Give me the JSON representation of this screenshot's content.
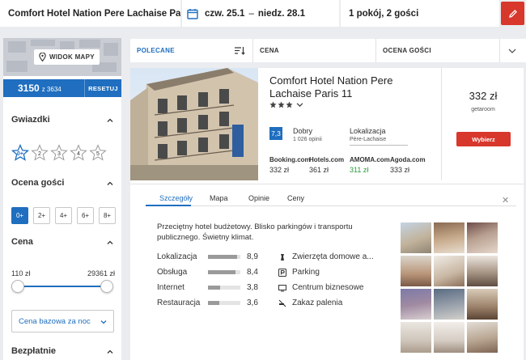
{
  "search": {
    "hotel": "Comfort Hotel Nation Pere Lachaise Pa",
    "date_from": "czw. 25.1",
    "date_sep": "–",
    "date_to": "niedz. 28.1",
    "guests": "1 pokój, 2 gości"
  },
  "sidebar": {
    "map_button": "WIDOK MAPY",
    "price_value": "3150",
    "price_of": "z 3634",
    "reset": "RESETUJ",
    "stars_title": "Gwiazdki",
    "stars": [
      "0+",
      "2",
      "3",
      "4",
      "5"
    ],
    "rating_title": "Ocena gości",
    "ratings": [
      "0+",
      "2+",
      "4+",
      "6+",
      "8+"
    ],
    "price_title": "Cena",
    "price_min": "110 zł",
    "price_max": "29361 zł",
    "price_dropdown": "Cena bazowa za noc",
    "free_title": "Bezpłatnie"
  },
  "sortbar": {
    "recommended": "POLECANE",
    "price": "CENA",
    "rating": "OCENA GOŚCI"
  },
  "hotel": {
    "name": "Comfort Hotel Nation Pere Lachaise Paris 11",
    "stars": 3,
    "rating": "7,3",
    "rating_text": "Dobry",
    "rating_count": "1 026 opinii",
    "location_label": "Lokalizacja",
    "location_value": "Père-Lachaise",
    "providers": [
      {
        "name": "Booking.com",
        "price": "332 zł"
      },
      {
        "name": "Hotels.com",
        "price": "361 zł"
      },
      {
        "name": "AMOMA.com",
        "price": "311 zł"
      },
      {
        "name": "Agoda.com",
        "price": "333 zł"
      }
    ],
    "best_price": "332 zł",
    "best_provider": "getaroom",
    "select_button": "Wybierz"
  },
  "details": {
    "tabs": [
      "Szczegóły",
      "Mapa",
      "Opinie",
      "Ceny"
    ],
    "description": "Przeciętny hotel budżetowy. Blisko parkingów i transportu publicznego. Świetny klimat.",
    "scores": [
      {
        "label": "Lokalizacja",
        "value": "8,9"
      },
      {
        "label": "Obsługa",
        "value": "8,4"
      },
      {
        "label": "Internet",
        "value": "3,8"
      },
      {
        "label": "Restauracja",
        "value": "3,6"
      }
    ],
    "amenities": [
      {
        "label": "Zwierzęta domowe a...",
        "icon": "pet-icon"
      },
      {
        "label": "Parking",
        "icon": "parking-icon"
      },
      {
        "label": "Centrum biznesowe",
        "icon": "business-center-icon"
      },
      {
        "label": "Zakaz palenia",
        "icon": "no-smoking-icon"
      }
    ]
  },
  "colors": {
    "brand_blue": "#1f6ebf",
    "accent_red": "#d8372c",
    "green_price": "#2a9c3d"
  }
}
